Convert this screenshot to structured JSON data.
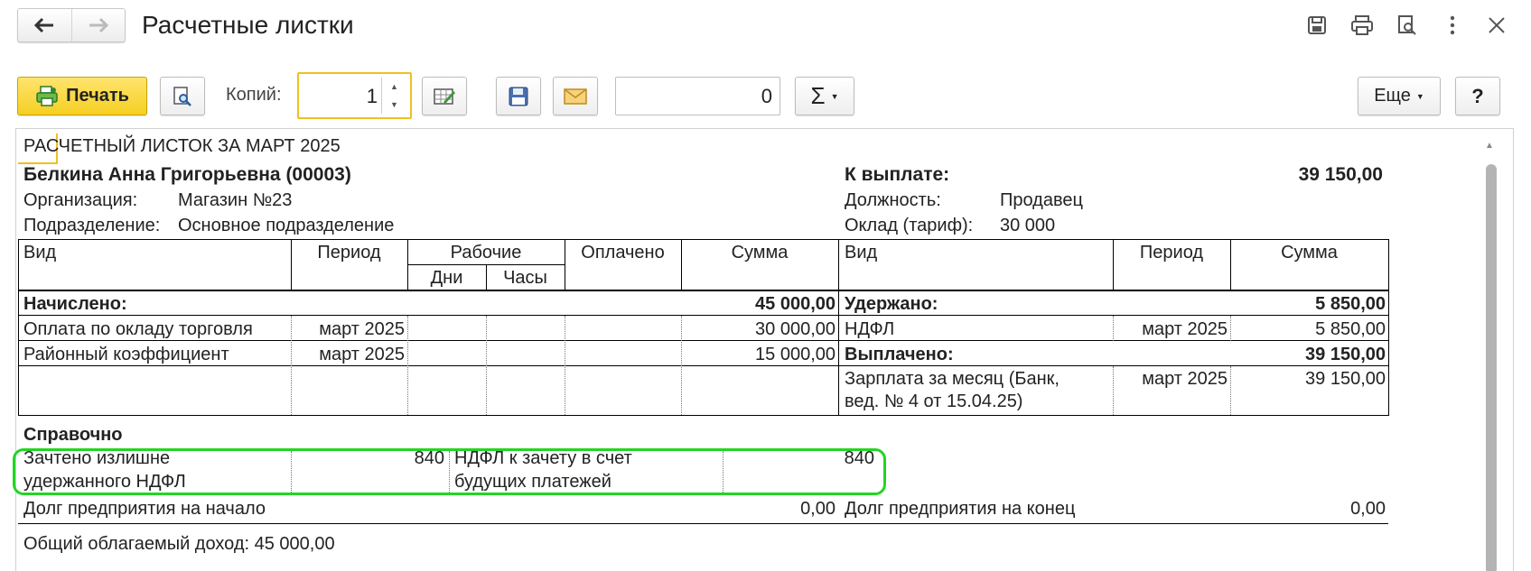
{
  "window": {
    "title": "Расчетные листки",
    "back_icon": "arrow-left-icon",
    "forward_icon": "arrow-right-icon"
  },
  "toolbar": {
    "print_label": "Печать",
    "copies_label": "Копий:",
    "copies_value": "1",
    "sum_value": "0",
    "sigma_label": "Σ",
    "more_label": "Еще",
    "help_label": "?"
  },
  "doc": {
    "title": "РАСЧЕТНЫЙ ЛИСТОК ЗА МАРТ 2025",
    "employee": "Белкина Анна Григорьевна (00003)",
    "org_label": "Организация:",
    "org_value": "Магазин №23",
    "dept_label": "Подразделение:",
    "dept_value": "Основное подразделение",
    "payout_label": "К выплате:",
    "payout_value": "39 150,00",
    "position_label": "Должность:",
    "position_value": "Продавец",
    "salary_label": "Оклад (тариф):",
    "salary_value": "30 000"
  },
  "table": {
    "headers_left": {
      "vid": "Вид",
      "period": "Период",
      "working": "Рабочие",
      "days": "Дни",
      "hours": "Часы",
      "paid": "Оплачено",
      "sum": "Сумма"
    },
    "headers_right": {
      "vid": "Вид",
      "period": "Период",
      "sum": "Сумма"
    },
    "accrued_label": "Начислено:",
    "accrued_total": "45 000,00",
    "withheld_label": "Удержано:",
    "withheld_total": "5 850,00",
    "left_rows": [
      {
        "vid": "Оплата по окладу торговля",
        "period": "март 2025",
        "sum": "30 000,00"
      },
      {
        "vid": "Районный коэффициент",
        "period": "март 2025",
        "sum": "15 000,00"
      }
    ],
    "ndfl": {
      "vid": "НДФЛ",
      "period": "март 2025",
      "sum": "5 850,00"
    },
    "paid_label": "Выплачено:",
    "paid_total": "39 150,00",
    "salary_row": {
      "vid_line1": "Зарплата за месяц (Банк,",
      "vid_line2": "вед. № 4 от 15.04.25)",
      "period": "март 2025",
      "sum": "39 150,00"
    }
  },
  "reference": {
    "title": "Справочно",
    "item1_line1": "Зачтено излишне",
    "item1_line2": "удержанного НДФЛ",
    "item1_value": "840",
    "item2_line1": "НДФЛ к зачету в счет",
    "item2_line2": "будущих платежей",
    "item2_value": "840",
    "debt_start_label": "Долг предприятия на начало",
    "debt_start_value": "0,00",
    "debt_end_label": "Долг предприятия на конец",
    "debt_end_value": "0,00",
    "taxable_income": "Общий облагаемый доход: 45 000,00"
  }
}
